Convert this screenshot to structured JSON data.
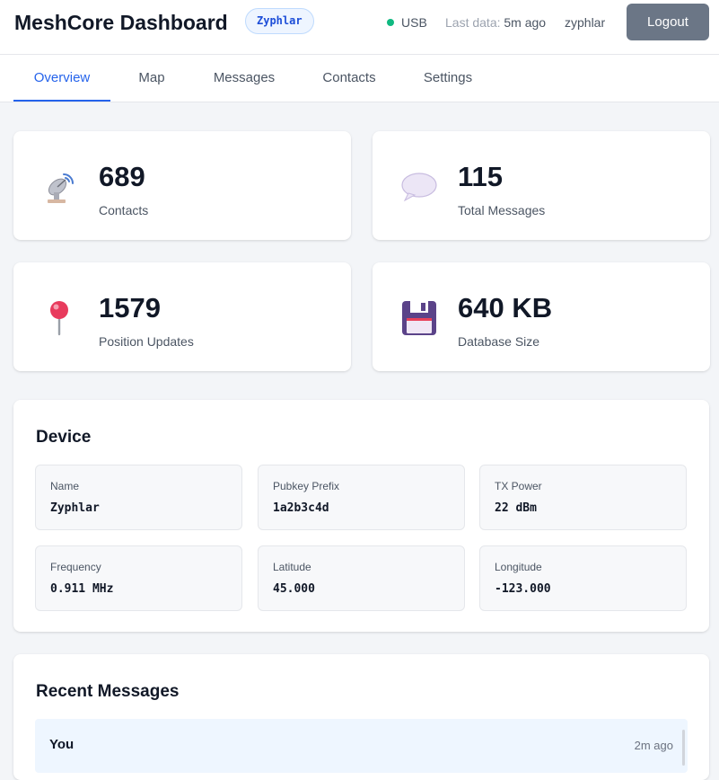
{
  "header": {
    "title": "MeshCore Dashboard",
    "device_badge": "Zyphlar",
    "connection": "USB",
    "last_data_label": "Last data:",
    "last_data_value": "5m ago",
    "username": "zyphlar",
    "logout_label": "Logout",
    "status_color": "#10b981"
  },
  "tabs": [
    {
      "label": "Overview",
      "active": true
    },
    {
      "label": "Map",
      "active": false
    },
    {
      "label": "Messages",
      "active": false
    },
    {
      "label": "Contacts",
      "active": false
    },
    {
      "label": "Settings",
      "active": false
    }
  ],
  "stats": [
    {
      "icon": "satellite-dish-icon",
      "value": "689",
      "label": "Contacts"
    },
    {
      "icon": "speech-bubble-icon",
      "value": "115",
      "label": "Total Messages"
    },
    {
      "icon": "pushpin-icon",
      "value": "1579",
      "label": "Position Updates"
    },
    {
      "icon": "floppy-disk-icon",
      "value": "640 KB",
      "label": "Database Size"
    }
  ],
  "device": {
    "title": "Device",
    "fields": [
      {
        "label": "Name",
        "value": "Zyphlar"
      },
      {
        "label": "Pubkey Prefix",
        "value": "1a2b3c4d"
      },
      {
        "label": "TX Power",
        "value": "22 dBm"
      },
      {
        "label": "Frequency",
        "value": "0.911 MHz"
      },
      {
        "label": "Latitude",
        "value": "45.000"
      },
      {
        "label": "Longitude",
        "value": "-123.000"
      }
    ]
  },
  "recent_messages": {
    "title": "Recent Messages",
    "items": [
      {
        "sender": "You",
        "time": "2m ago"
      }
    ]
  },
  "colors": {
    "accent": "#2563eb",
    "logout_bg": "#6b7686",
    "page_bg": "#f3f5f8"
  }
}
